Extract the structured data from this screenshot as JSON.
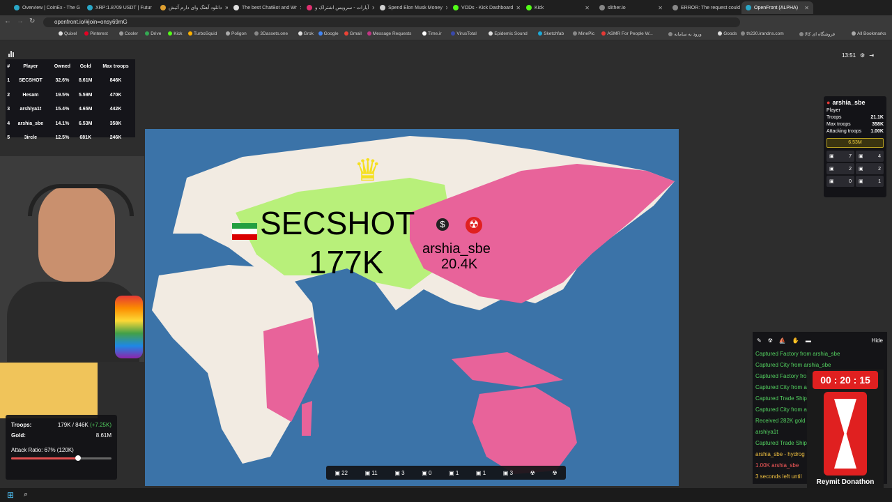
{
  "tabs": [
    {
      "title": "Overview | CoinEx - The G",
      "color": "#2aa7c7"
    },
    {
      "title": "XRP:1.8709 USDT | Futur",
      "color": "#2aa7c7"
    },
    {
      "title": "دانلود آهنگ وای دارم آتیش",
      "color": "#e0a030"
    },
    {
      "title": "The best ChatBot and Wr",
      "color": "#e0e0e0"
    },
    {
      "title": "آپارات - سرویس اشتراک و",
      "color": "#e03070"
    },
    {
      "title": "Spend Elon Musk Money",
      "color": "#d0d0d0"
    },
    {
      "title": "VODs - Kick Dashboard",
      "color": "#53fc18"
    },
    {
      "title": "Kick",
      "color": "#53fc18"
    },
    {
      "title": "slither.io",
      "color": "#888888"
    },
    {
      "title": "ERROR: The request could",
      "color": "#888888"
    },
    {
      "title": "OpenFront (ALPHA)",
      "color": "#2aa7c7"
    }
  ],
  "url": "openfront.io/#join=onsy69mG",
  "bookmarks": [
    {
      "label": "Quixel",
      "color": "#ddd"
    },
    {
      "label": "Pinterest",
      "color": "#e60023"
    },
    {
      "label": "Cooler",
      "color": "#999"
    },
    {
      "label": "Drive",
      "color": "#34a853"
    },
    {
      "label": "Kick",
      "color": "#53fc18"
    },
    {
      "label": "TurboSquid",
      "color": "#ffb000"
    },
    {
      "label": "Poligon",
      "color": "#aaa"
    },
    {
      "label": "3Dassets.one",
      "color": "#888"
    },
    {
      "label": "Grok",
      "color": "#ddd"
    },
    {
      "label": "Google",
      "color": "#4285f4"
    },
    {
      "label": "Gmail",
      "color": "#ea4335"
    },
    {
      "label": "Message Requests",
      "color": "#c13584"
    },
    {
      "label": "Time.ir",
      "color": "#fff"
    },
    {
      "label": "VirusTotal",
      "color": "#3949ab"
    },
    {
      "label": "Epidemic Sound",
      "color": "#ddd"
    },
    {
      "label": "Sketchfab",
      "color": "#1caad9"
    },
    {
      "label": "MinePic",
      "color": "#888"
    },
    {
      "label": "ASMR For People W...",
      "color": "#e53935"
    },
    {
      "label": "ورود به سامانه",
      "color": "#888"
    },
    {
      "label": "Goods",
      "color": "#ddd"
    },
    {
      "label": "th230.irandns.com",
      "color": "#888"
    },
    {
      "label": "فروشگاه ای کالا",
      "color": "#888"
    },
    {
      "label": "All Bookmarks",
      "color": "#aaa"
    }
  ],
  "leaderboard": {
    "headers": [
      "#",
      "Player",
      "Owned",
      "Gold",
      "Max troops"
    ],
    "rows": [
      [
        "1",
        "SECSHOT",
        "32.6%",
        "8.61M",
        "846K"
      ],
      [
        "2",
        "Hesam",
        "19.5%",
        "5.59M",
        "470K"
      ],
      [
        "3",
        "arshiya1t",
        "15.4%",
        "4.65M",
        "442K"
      ],
      [
        "4",
        "arshia_sbe",
        "14.1%",
        "6.53M",
        "358K"
      ],
      [
        "5",
        "3ircle",
        "12.5%",
        "681K",
        "246K"
      ]
    ]
  },
  "top_right": {
    "time": "13:51"
  },
  "map": {
    "big_name": "SECSHOT",
    "big_troops": "177K",
    "enemy_name": "arshia_sbe",
    "enemy_troops": "20.4K",
    "ocean": "#3b73a8",
    "land": "#f2ebe2",
    "mine": "#b8f07a",
    "enemy": "#e8639a"
  },
  "player_panel": {
    "name": "arshia_sbe",
    "type": "Player",
    "rows": [
      [
        "Troops",
        "21.1K"
      ],
      [
        "Max troops",
        "358K"
      ],
      [
        "Attacking troops",
        "1.00K"
      ]
    ],
    "gold": "6.53M",
    "grid": [
      [
        "7",
        "4"
      ],
      [
        "2",
        "2"
      ],
      [
        "0",
        "1"
      ]
    ]
  },
  "events": {
    "hide": "Hide",
    "items": [
      {
        "text": "Captured Factory from arshia_sbe",
        "color": "#53d160"
      },
      {
        "text": "Captured City from arshia_sbe",
        "color": "#53d160"
      },
      {
        "text": "Captured Factory fro",
        "color": "#53d160"
      },
      {
        "text": "Captured City from a",
        "color": "#53d160"
      },
      {
        "text": "Captured Trade Ship",
        "color": "#53d160"
      },
      {
        "text": "Captured City from a",
        "color": "#53d160"
      },
      {
        "text": "Received 282K gold",
        "color": "#53d160"
      },
      {
        "text": "arshiya1t",
        "color": "#53d160"
      },
      {
        "text": "Captured Trade Ship",
        "color": "#53d160"
      },
      {
        "text": "arshia_sbe - hydrog",
        "color": "#f0c040"
      },
      {
        "text": "1.00K arshia_sbe",
        "color": "#ff5c5c"
      },
      {
        "text": "3 seconds left until",
        "color": "#f0c040"
      }
    ]
  },
  "stats": {
    "troops_label": "Troops:",
    "troops_value": "179K / 846K",
    "troops_delta": "(+7.25K)",
    "gold_label": "Gold:",
    "gold_value": "8.61M",
    "ratio_label": "Attack Ratio: 67% (120K)",
    "ratio": 0.67
  },
  "bottombar": [
    "22",
    "11",
    "3",
    "0",
    "1",
    "1",
    "3"
  ],
  "timer": {
    "time": "00 : 20 : 15",
    "name": "Reymit Donathon"
  }
}
